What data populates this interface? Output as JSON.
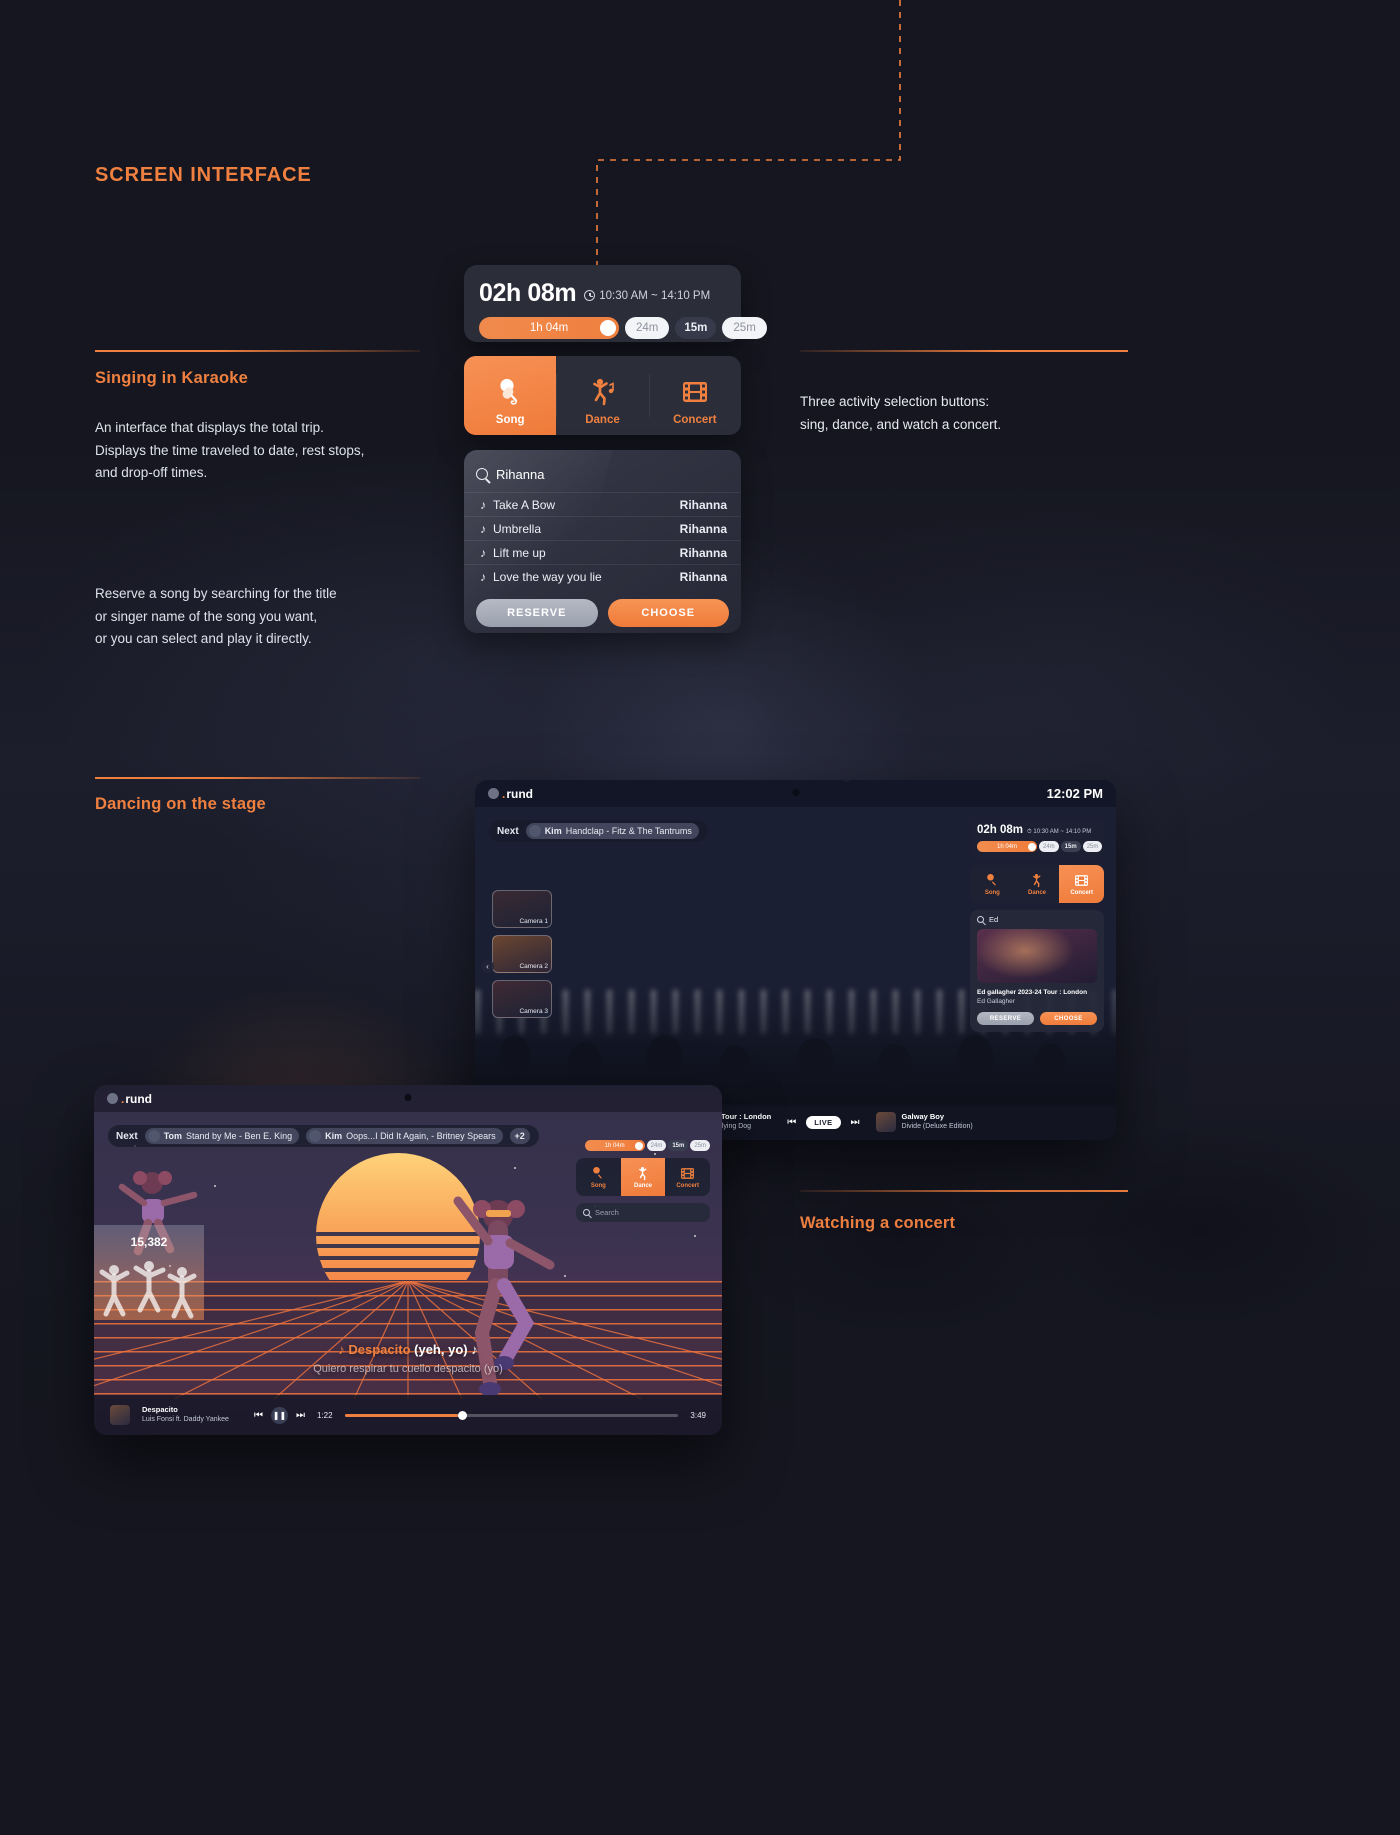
{
  "page": {
    "section_title": "SCREEN INTERFACE",
    "accent": "#ef8040",
    "background": "#15161f"
  },
  "blocks": [
    {
      "heading": "Singing in Karaoke",
      "body_1": "An interface that displays the total trip.\nDisplays the time traveled to date, rest stops,\nand drop-off times.",
      "body_2": "Reserve a song by searching for the title\nor singer name of the song you want,\nor you can select and play it directly."
    },
    {
      "heading": "Dancing on the stage"
    },
    {
      "heading": "Watching a concert"
    }
  ],
  "annotations": {
    "activity_note": "Three activity selection buttons:\nsing, dance, and watch a concert."
  },
  "timer": {
    "elapsed": "02h 08m",
    "clock_icon": "clock-icon",
    "range": "10:30 AM ~ 14:10 PM",
    "segments": [
      {
        "label": "1h 04m",
        "style": "filled"
      },
      {
        "label": "24m",
        "style": "white"
      },
      {
        "label": "15m",
        "style": "dark"
      },
      {
        "label": "25m",
        "style": "white"
      }
    ]
  },
  "activities": [
    {
      "label": "Song",
      "icon": "microphone-icon",
      "selected": true
    },
    {
      "label": "Dance",
      "icon": "dancer-icon",
      "selected": false
    },
    {
      "label": "Concert",
      "icon": "film-strip-icon",
      "selected": false
    }
  ],
  "search_panel": {
    "icon": "search-icon",
    "query": "Rihanna",
    "placeholder": "Search",
    "results": [
      {
        "icon": "music-note-icon",
        "title": "Take A Bow",
        "artist": "Rihanna"
      },
      {
        "icon": "music-note-icon",
        "title": "Umbrella",
        "artist": "Rihanna"
      },
      {
        "icon": "music-note-icon",
        "title": "Lift me up",
        "artist": "Rihanna"
      },
      {
        "icon": "music-note-icon",
        "title": "Love the way you lie",
        "artist": "Rihanna"
      }
    ],
    "reserve_label": "RESERVE",
    "choose_label": "CHOOSE"
  },
  "concert_tablet": {
    "brand": "rund",
    "brand_dot": ".",
    "clock": "12:02 PM",
    "next_label": "Next",
    "next_chips": [
      {
        "who": "Kim",
        "text": "Handclap - Fitz & The Tantrums"
      }
    ],
    "cameras": [
      {
        "label": "Camera 1"
      },
      {
        "label": "Camera 2"
      },
      {
        "label": "Camera 3"
      }
    ],
    "prev_arrow": "‹",
    "timer": {
      "elapsed": "02h 08m",
      "range": "10:30 AM ~ 14:10 PM",
      "segments": [
        {
          "label": "1h 04m",
          "style": "filled"
        },
        {
          "label": "24m",
          "style": "white"
        },
        {
          "label": "15m",
          "style": "dark"
        },
        {
          "label": "25m",
          "style": "white"
        }
      ]
    },
    "activities": [
      {
        "label": "Song",
        "icon": "microphone-icon",
        "selected": false
      },
      {
        "label": "Dance",
        "icon": "dancer-icon",
        "selected": false
      },
      {
        "label": "Concert",
        "icon": "film-strip-icon",
        "selected": true
      }
    ],
    "search": {
      "icon": "search-icon",
      "query": "Ed",
      "result_title": "Ed gallagher 2023-24 Tour : London",
      "result_artist": "Ed Gallagher",
      "reserve_label": "RESERVE",
      "choose_label": "CHOOSE"
    },
    "player": {
      "now_title": "Ed gallagher 2023-24 Tour : London",
      "now_subtitle": "by Ed Gallagher's High Flying Dog",
      "live_label": "LIVE",
      "prev_icon": "skip-previous-icon",
      "next_icon": "skip-next-icon",
      "up_next_title": "Galway Boy",
      "up_next_subtitle": "Divide (Deluxe Edition)"
    }
  },
  "dance_tablet": {
    "brand": "rund",
    "brand_dot": ".",
    "next_label": "Next",
    "next_chips": [
      {
        "who": "Tom",
        "text": "Stand by Me - Ben E. King"
      },
      {
        "who": "Kim",
        "text": "Oops...I Did It Again, - Britney Spears"
      }
    ],
    "more_chip": "+2",
    "score": "15,382",
    "timer_segments": [
      {
        "label": "1h 04m",
        "style": "filled"
      },
      {
        "label": "24m",
        "style": "white"
      },
      {
        "label": "15m",
        "style": "dark"
      },
      {
        "label": "25m",
        "style": "white"
      }
    ],
    "activities": [
      {
        "label": "Song",
        "icon": "microphone-icon",
        "selected": false
      },
      {
        "label": "Dance",
        "icon": "dancer-icon",
        "selected": true
      },
      {
        "label": "Concert",
        "icon": "film-strip-icon",
        "selected": false
      }
    ],
    "search_placeholder": "Search",
    "search_icon": "search-icon",
    "lyric_main_a": "♪ Despacito",
    "lyric_main_b": "(yeh, yo) ♪",
    "lyric_sub": "Quiero respirar tu cuello despacito (yo)",
    "player": {
      "title": "Despacito",
      "subtitle": "Luis Fonsi ft. Daddy Yankee",
      "prev_icon": "skip-previous-icon",
      "pause_icon": "pause-icon",
      "next_icon": "skip-next-icon",
      "elapsed": "1:22",
      "duration": "3:49"
    }
  }
}
